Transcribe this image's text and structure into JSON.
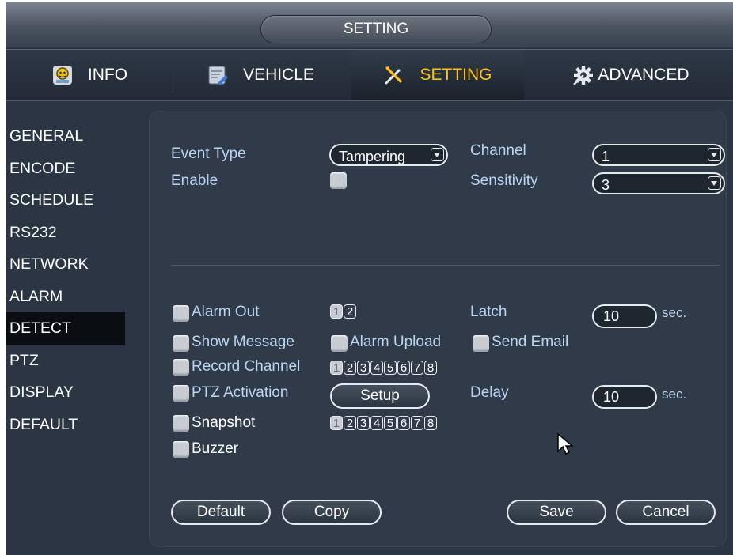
{
  "window": {
    "title": "SETTING"
  },
  "tabs": [
    {
      "label": "INFO",
      "icon": "info-icon"
    },
    {
      "label": "VEHICLE",
      "icon": "vehicle-icon"
    },
    {
      "label": "SETTING",
      "icon": "tools-icon",
      "active": true
    },
    {
      "label": "ADVANCED",
      "icon": "gear-icon"
    }
  ],
  "sidebar": {
    "items": [
      "GENERAL",
      "ENCODE",
      "SCHEDULE",
      "RS232",
      "NETWORK",
      "ALARM",
      "DETECT",
      "PTZ",
      "DISPLAY",
      "DEFAULT"
    ],
    "active": "DETECT"
  },
  "form": {
    "event_type_label": "Event Type",
    "event_type_value": "Tampering",
    "channel_label": "Channel",
    "channel_value": "1",
    "enable_label": "Enable",
    "sensitivity_label": "Sensitivity",
    "sensitivity_value": "3"
  },
  "actions": {
    "alarm_out_label": "Alarm Out",
    "alarm_out_channels": [
      "1",
      "2"
    ],
    "latch_label": "Latch",
    "latch_value": "10",
    "latch_unit": "sec.",
    "show_message_label": "Show Message",
    "alarm_upload_label": "Alarm Upload",
    "send_email_label": "Send Email",
    "record_channel_label": "Record Channel",
    "record_channels": [
      "1",
      "2",
      "3",
      "4",
      "5",
      "6",
      "7",
      "8"
    ],
    "ptz_activation_label": "PTZ Activation",
    "setup_label": "Setup",
    "delay_label": "Delay",
    "delay_value": "10",
    "delay_unit": "sec.",
    "snapshot_label": "Snapshot",
    "snapshot_channels": [
      "1",
      "2",
      "3",
      "4",
      "5",
      "6",
      "7",
      "8"
    ],
    "buzzer_label": "Buzzer"
  },
  "buttons": {
    "default": "Default",
    "copy": "Copy",
    "save": "Save",
    "cancel": "Cancel"
  },
  "colors": {
    "background": "#2b3543",
    "panel": "#303a48",
    "label_blue": "#b9d6f5",
    "active_tab_text": "#ffc21a",
    "active_sidebar": "#0a0d12"
  }
}
